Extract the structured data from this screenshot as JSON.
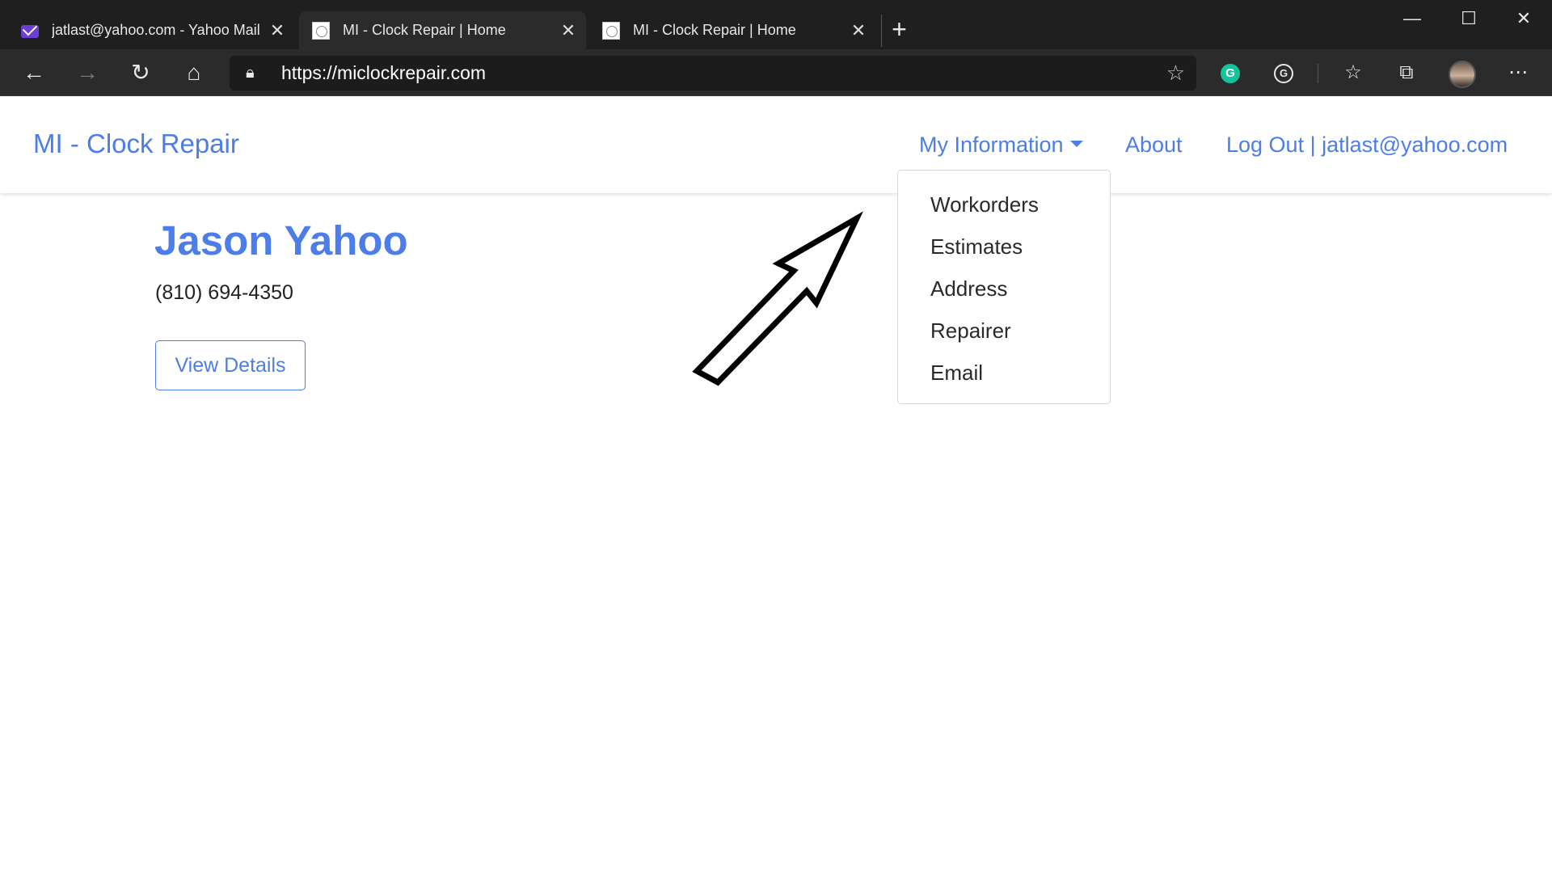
{
  "browser": {
    "tabs": [
      {
        "title": "jatlast@yahoo.com - Yahoo Mail",
        "icon": "yahoo-mail-icon",
        "active": false
      },
      {
        "title": "MI - Clock Repair | Home",
        "icon": "site-favicon-icon",
        "active": true
      },
      {
        "title": "MI - Clock Repair | Home",
        "icon": "site-favicon-icon",
        "active": false
      }
    ],
    "address": {
      "url": "https://miclockrepair.com"
    },
    "extensions": {
      "grammarly_letter": "G",
      "grammarly2_letter": "G"
    }
  },
  "site": {
    "brand": "MI - Clock Repair",
    "nav": {
      "my_information": "My Information",
      "about": "About",
      "logout": "Log Out | jatlast@yahoo.com"
    },
    "dropdown": {
      "items": [
        "Workorders",
        "Estimates",
        "Address",
        "Repairer",
        "Email"
      ]
    },
    "profile": {
      "name": "Jason Yahoo",
      "phone": "(810) 694-4350",
      "button": "View Details"
    }
  },
  "colors": {
    "link_blue": "#4c7de9",
    "chrome_dark": "#1f1f1f",
    "toolbar_dark": "#2b2b2b"
  }
}
